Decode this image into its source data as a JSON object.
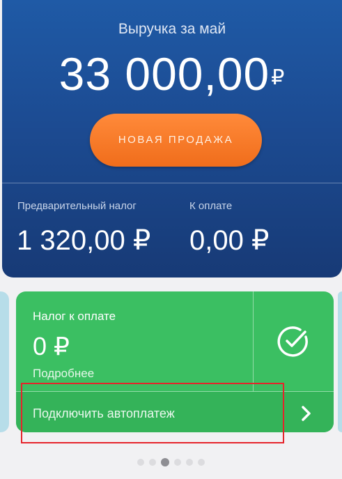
{
  "header": {
    "revenue_title": "Выручка за май",
    "revenue_amount": "33 000,00",
    "currency_symbol": "₽",
    "new_sale_label": "НОВАЯ ПРОДАЖА",
    "preliminary_tax_label": "Предварительный налог",
    "preliminary_tax_value": "1 320,00 ₽",
    "to_pay_label": "К оплате",
    "to_pay_value": "0,00 ₽"
  },
  "tax_card": {
    "title": "Налог к оплате",
    "amount": "0 ₽",
    "details_link": "Подробнее",
    "status_icon": "check-circle-icon",
    "autopay_label": "Подключить автоплатеж",
    "autopay_icon": "chevron-right-icon",
    "color": "#3bbf62"
  },
  "pager": {
    "total": 6,
    "active_index": 2
  },
  "colors": {
    "header_top": "#1f5aa6",
    "header_bottom": "#173a76",
    "accent_orange": "#f06d1b",
    "highlight": "#e5242b"
  }
}
